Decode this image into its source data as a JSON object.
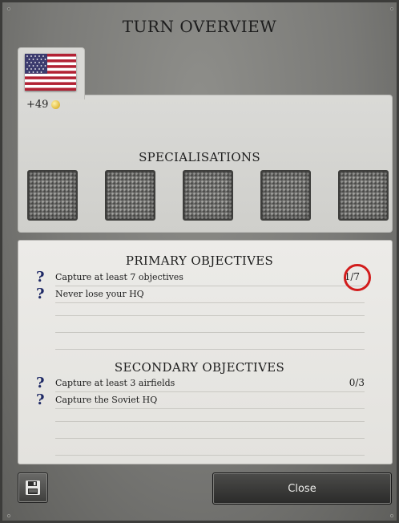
{
  "header": {
    "title": "TURN OVERVIEW"
  },
  "player": {
    "flag_icon": "us-flag-icon",
    "score": "+49",
    "currency_icon": "coin-icon"
  },
  "specialisations": {
    "title": "SPECIALISATIONS",
    "slots": [
      "empty",
      "empty",
      "empty",
      "empty",
      "empty"
    ]
  },
  "primary": {
    "title": "PRIMARY OBJECTIVES",
    "items": [
      {
        "text": "Capture at least 7 objectives",
        "count": "1/7"
      },
      {
        "text": "Never lose your HQ",
        "count": ""
      }
    ]
  },
  "secondary": {
    "title": "SECONDARY OBJECTIVES",
    "items": [
      {
        "text": "Capture at least 3 airfields",
        "count": "0/3"
      },
      {
        "text": "Capture the Soviet HQ",
        "count": ""
      }
    ]
  },
  "footer": {
    "save_icon": "floppy-disk-icon",
    "close_label": "Close"
  },
  "colors": {
    "highlight_ring": "#d21c1c",
    "help_icon": "#1f2a66"
  }
}
